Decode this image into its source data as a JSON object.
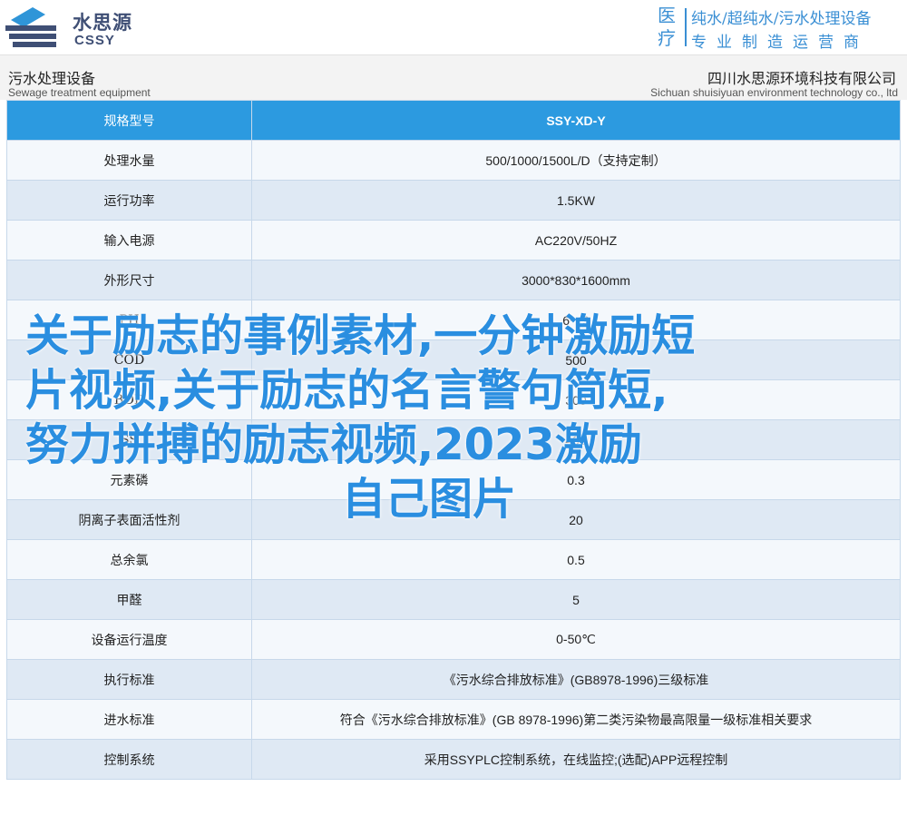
{
  "logo": {
    "cn": "水思源",
    "en": "CSSY"
  },
  "badge": {
    "big": "医疗",
    "line1": "纯水/超纯水/污水处理设备",
    "line2": "专业制造运营商"
  },
  "header": {
    "left_cn": "污水处理设备",
    "left_en": "Sewage treatment equipment",
    "right_cn": "四川水思源环境科技有限公司",
    "right_en": "Sichuan shuisiyuan environment technology co., ltd"
  },
  "table": {
    "head": {
      "label": "规格型号",
      "value": "SSY-XD-Y"
    },
    "rows": [
      {
        "label": "处理水量",
        "value": "500/1000/1500L/D（支持定制）"
      },
      {
        "label": "运行功率",
        "value": "1.5KW"
      },
      {
        "label": "输入电源",
        "value": "AC220V/50HZ"
      },
      {
        "label": "外形尺寸",
        "value": "3000*830*1600mm"
      },
      {
        "label": "PH",
        "value": "6～9"
      },
      {
        "label": "COD",
        "value": "500"
      },
      {
        "label": "BOD",
        "value": "300"
      },
      {
        "label": "SS",
        "value": "400"
      },
      {
        "label": "元素磷",
        "value": "0.3"
      },
      {
        "label": "阴离子表面活性剂",
        "value": "20"
      },
      {
        "label": "总余氯",
        "value": "0.5"
      },
      {
        "label": "甲醛",
        "value": "5"
      },
      {
        "label": "设备运行温度",
        "value": "0-50℃"
      },
      {
        "label": "执行标准",
        "value": "《污水综合排放标准》(GB8978-1996)三级标准"
      },
      {
        "label": "进水标准",
        "value": "符合《污水综合排放标准》(GB 8978-1996)第二类污染物最高限量一级标准相关要求"
      },
      {
        "label": "控制系统",
        "value": "采用SSYPLC控制系统，在线监控;(选配)APP远程控制"
      }
    ]
  },
  "overlay": {
    "line1": "关于励志的事例素材,一分钟激励短",
    "line2": "片视频,关于励志的名言警句简短,",
    "line3": "努力拼搏的励志视频,2023激励",
    "line4": "自己图片"
  },
  "colors": {
    "accent": "#2c9ae0",
    "logo": "#3f4f75",
    "row_alt": "#dfe9f4",
    "overlay_text": "#2a8ee0"
  }
}
